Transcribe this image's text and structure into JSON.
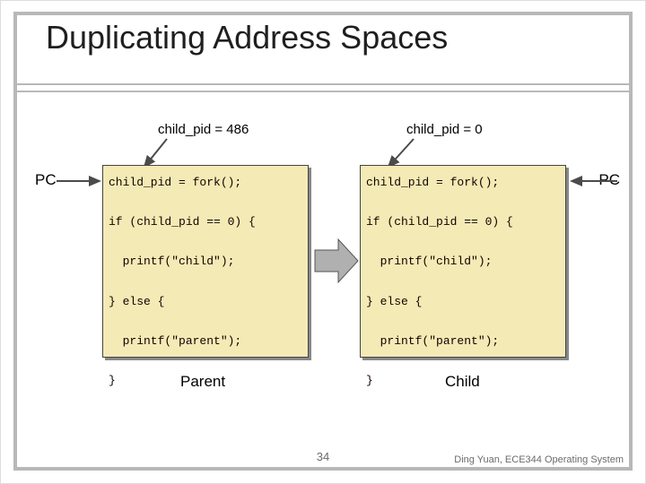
{
  "title": "Duplicating Address Spaces",
  "top_labels": {
    "left": "child_pid = 486",
    "right": "child_pid = 0"
  },
  "pc_label": "PC",
  "code": {
    "l1": "child_pid = fork();",
    "l2": "if (child_pid == 0) {",
    "l3": "  printf(\"child\");",
    "l4": "} else {",
    "l5": "  printf(\"parent\");",
    "l6": "}"
  },
  "captions": {
    "left": "Parent",
    "right": "Child"
  },
  "slide_number": "34",
  "footer": "Ding Yuan, ECE344 Operating System",
  "colors": {
    "codebg": "#f4eab5",
    "border": "#b8b8b8",
    "arrow_thin": "#4b4b4b",
    "arrow_block": "#b0b0b0"
  }
}
